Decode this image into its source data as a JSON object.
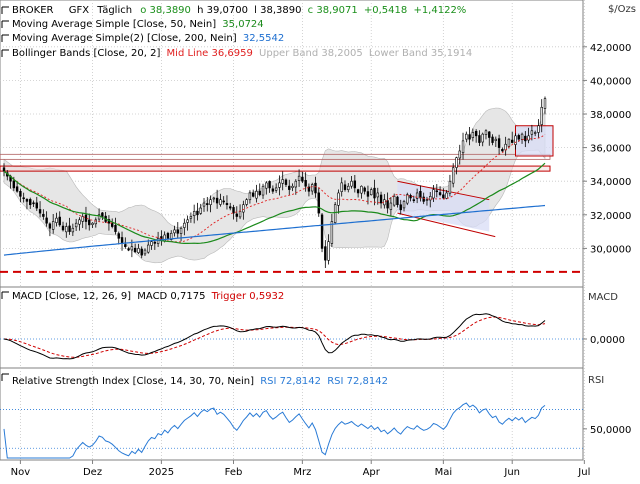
{
  "header": {
    "symbol": "BROKER",
    "instrument": "GFX",
    "period": "Täglich",
    "open": "o 38,3890",
    "high": "h 39,0700",
    "low": "l 38,3890",
    "close": "c 38,9071",
    "change": "+0,5418",
    "change_pct": "+1,4122%"
  },
  "legend": {
    "ma50_label": "Moving Average Simple  [Close, 50, Nein]",
    "ma50_value": "35,0724",
    "ma200_label": "Moving Average Simple(2)  [Close, 200, Nein]",
    "ma200_value": "32,5542",
    "bb_label": "Bollinger Bands  [Close, 20, 2]",
    "bb_mid": "Mid Line 36,6959",
    "bb_upper": "Upper Band 38,2005",
    "bb_lower": "Lower Band 35,1914"
  },
  "macd_legend": {
    "label": "MACD  [Close, 12, 26, 9]",
    "macd": "MACD 0,7175",
    "trigger": "Trigger 0,5932",
    "axis_label": "MACD"
  },
  "rsi_legend": {
    "label": "Relative Strength Index  [Close, 14, 30, 70, Nein]",
    "rsi1": "RSI 72,8142",
    "rsi2": "RSI 72,8142",
    "axis_label": "RSI"
  },
  "unit_label": "$/Ozs",
  "colors": {
    "up": "#000000",
    "down": "#000000",
    "ma50": "#1b8a1b",
    "ma200": "#1e6fd0",
    "bb_mid": "#e02020",
    "bb_fill": "#e6e6e6",
    "resistance": "#c00000",
    "support_dashed": "#d00000",
    "channel_fill": "#d8dcf6",
    "channel_line": "#c00000",
    "rsi": "#2a7bd6",
    "macd": "#000000",
    "trigger": "#d00000",
    "change": "#1a8f1a"
  },
  "chart_data": [
    {
      "type": "candlestick",
      "title": "GFX Täglich",
      "ylabel": "$/Ozs",
      "ylim": [
        28.0,
        43.0
      ],
      "y_ticks": [
        "30,0000",
        "32,0000",
        "34,0000",
        "36,0000",
        "38,0000",
        "40,0000",
        "42,0000"
      ],
      "y_tick_values": [
        30,
        32,
        34,
        36,
        38,
        40,
        42
      ],
      "x_ticks": [
        "Nov",
        "Dez",
        "2025",
        "Feb",
        "Mrz",
        "Apr",
        "Mai",
        "Jun",
        "Jul"
      ],
      "x_tick_index": [
        5,
        27,
        48,
        70,
        91,
        112,
        134,
        155,
        177
      ],
      "close": [
        34.6,
        34.3,
        34.0,
        33.6,
        33.4,
        33.1,
        33.0,
        32.8,
        32.6,
        32.7,
        32.4,
        32.1,
        31.9,
        31.5,
        31.2,
        31.6,
        31.8,
        31.4,
        31.1,
        31.3,
        31.0,
        31.2,
        31.5,
        31.7,
        31.9,
        31.6,
        31.4,
        31.5,
        31.7,
        32.0,
        31.9,
        31.6,
        31.5,
        31.3,
        31.0,
        30.6,
        30.3,
        30.1,
        29.9,
        30.1,
        29.8,
        30.0,
        29.6,
        29.9,
        30.2,
        30.4,
        30.3,
        30.6,
        30.5,
        30.8,
        30.6,
        30.9,
        31.1,
        30.9,
        31.2,
        31.5,
        31.7,
        31.9,
        32.2,
        32.0,
        32.4,
        32.7,
        32.6,
        32.9,
        33.0,
        32.7,
        32.9,
        32.8,
        32.6,
        32.4,
        32.1,
        31.9,
        32.2,
        32.6,
        32.9,
        33.3,
        33.1,
        33.4,
        33.2,
        33.7,
        33.9,
        33.6,
        33.4,
        33.6,
        33.9,
        34.1,
        33.8,
        33.5,
        33.7,
        34.0,
        34.3,
        34.0,
        33.7,
        33.4,
        33.8,
        33.3,
        32.1,
        30.0,
        29.3,
        30.4,
        31.6,
        32.6,
        33.3,
        33.9,
        33.5,
        33.7,
        34.0,
        33.6,
        33.3,
        33.7,
        33.4,
        33.1,
        33.5,
        33.0,
        33.3,
        32.7,
        32.9,
        32.4,
        32.7,
        33.1,
        32.6,
        32.3,
        32.8,
        33.2,
        33.0,
        32.9,
        33.3,
        33.0,
        32.8,
        32.9,
        33.1,
        33.5,
        33.4,
        33.2,
        33.0,
        33.3,
        34.0,
        34.8,
        35.4,
        35.8,
        36.4,
        36.8,
        36.5,
        36.9,
        36.7,
        36.3,
        36.8,
        37.0,
        36.6,
        36.3,
        36.5,
        36.0,
        35.8,
        36.2,
        36.5,
        36.3,
        36.7,
        36.5,
        36.8,
        36.4,
        36.7,
        37.0,
        36.9,
        37.3,
        38.4,
        38.91
      ],
      "support_levels": [
        28.6
      ],
      "resistance_band": [
        34.6,
        34.9
      ],
      "upper_resistance_band": [
        35.3,
        35.6
      ],
      "series": [
        {
          "name": "Moving Average Simple [Close, 50, Nein]",
          "last": 35.0724
        },
        {
          "name": "Moving Average Simple(2) [Close, 200, Nein]",
          "last": 32.5542
        },
        {
          "name": "Bollinger Bands [Close, 20, 2]",
          "mid": 36.6959,
          "upper": 38.2005,
          "lower": 35.1914
        }
      ]
    },
    {
      "type": "line",
      "title": "MACD [Close, 12, 26, 9]",
      "y_ticks": [
        "0,0000"
      ],
      "ylim": [
        -1.0,
        1.4
      ],
      "series": [
        {
          "name": "MACD",
          "last": 0.7175
        },
        {
          "name": "Trigger",
          "last": 0.5932
        }
      ]
    },
    {
      "type": "line",
      "title": "Relative Strength Index [Close, 14, 30, 70, Nein]",
      "y_ticks": [
        "50,0000"
      ],
      "ylim": [
        20,
        90
      ],
      "levels": [
        70,
        30
      ],
      "series": [
        {
          "name": "RSI",
          "last": 72.8142
        }
      ]
    }
  ]
}
